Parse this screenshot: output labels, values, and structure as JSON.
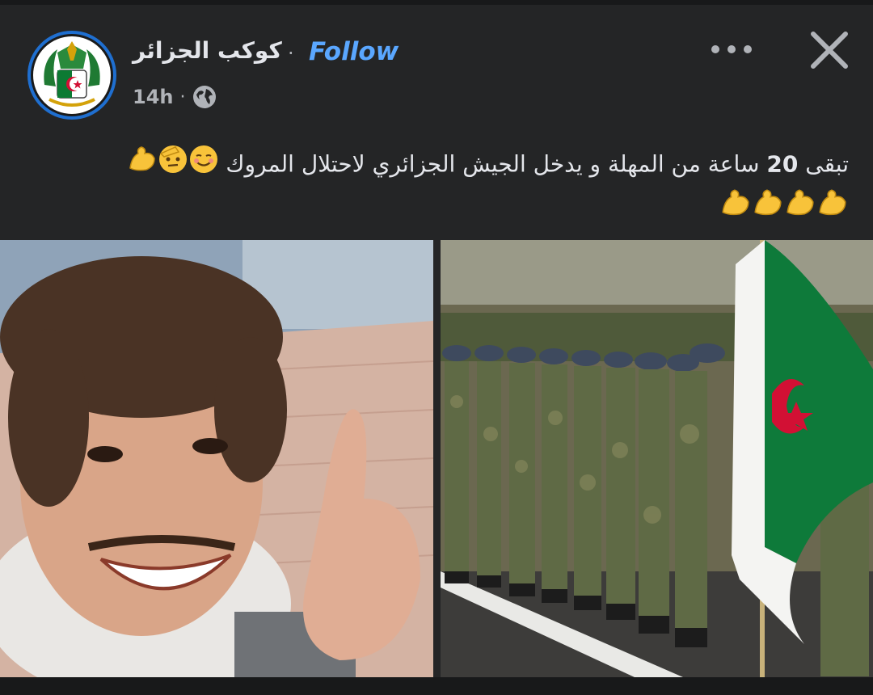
{
  "post": {
    "author": "كوكب الجزائر",
    "separator": "·",
    "follow_label": "Follow",
    "time": "14h",
    "meta_separator": "·",
    "caption_part1": "تبقى ",
    "caption_number": "20",
    "caption_part2": " ساعة من المهلة و يدخل الجيش الجزائري لاحتلال المروك",
    "caption_emojis_line1": [
      "smiling-face-icon",
      "saluting-face-icon",
      "flexed-biceps-icon"
    ],
    "caption_emojis_line2": [
      "flexed-biceps-icon",
      "flexed-biceps-icon",
      "flexed-biceps-icon",
      "flexed-biceps-icon"
    ]
  },
  "icons": {
    "privacy": "globe-icon",
    "more": "more-options-icon",
    "close": "close-icon"
  },
  "colors": {
    "background": "#242526",
    "follow": "#5aa7ff",
    "secondary_text": "#b0b3b8",
    "avatar_ring": "#1f6fd0"
  }
}
